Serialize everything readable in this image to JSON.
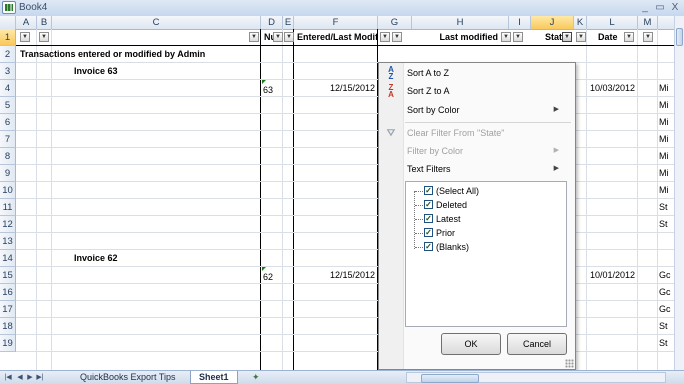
{
  "window": {
    "title": "Book4",
    "minimize": "_",
    "restore": "▭",
    "close": "X"
  },
  "columns": [
    "A",
    "B",
    "C",
    "D",
    "E",
    "F",
    "G",
    "H",
    "I",
    "J",
    "K",
    "L",
    "M"
  ],
  "rows": [
    "1",
    "2",
    "3",
    "4",
    "5",
    "6",
    "7",
    "8",
    "9",
    "10",
    "11",
    "12",
    "13",
    "14",
    "15",
    "16",
    "17",
    "18",
    "19"
  ],
  "header_row": {
    "d": "Nu",
    "f": "Entered/Last Modifi",
    "h": "Last modified",
    "j": "Stat",
    "l": "Date"
  },
  "cells": {
    "title": "Transactions entered or modified by Admin",
    "invoice_63": "Invoice 63",
    "invoice_62": "Invoice 62",
    "num_63": "63",
    "num_62": "62",
    "entered_63": "12/15/2012",
    "entered_62": "12/15/2012",
    "date_63": "10/03/2012",
    "date_62": "10/01/2012",
    "m_col": [
      "Mi",
      "Mi",
      "Mi",
      "Mi",
      "Mi",
      "Mi",
      "Mi",
      "St",
      "St",
      "Gc",
      "Gc",
      "Gc",
      "St",
      "St"
    ]
  },
  "filter_menu": {
    "sort_az": "Sort A to Z",
    "sort_za": "Sort Z to A",
    "sort_color": "Sort by Color",
    "clear_filter": "Clear Filter From \"State\"",
    "filter_color": "Filter by Color",
    "text_filters": "Text Filters",
    "options": [
      "(Select All)",
      "Deleted",
      "Latest",
      "Prior",
      "(Blanks)"
    ],
    "ok": "OK",
    "cancel": "Cancel"
  },
  "sheet_tabs": {
    "tab1": "QuickBooks Export Tips",
    "tab2": "Sheet1"
  },
  "colors": {
    "accent": "#f9c85a",
    "titlebar": "#c6d7ee",
    "checkmark": "#214d21"
  }
}
